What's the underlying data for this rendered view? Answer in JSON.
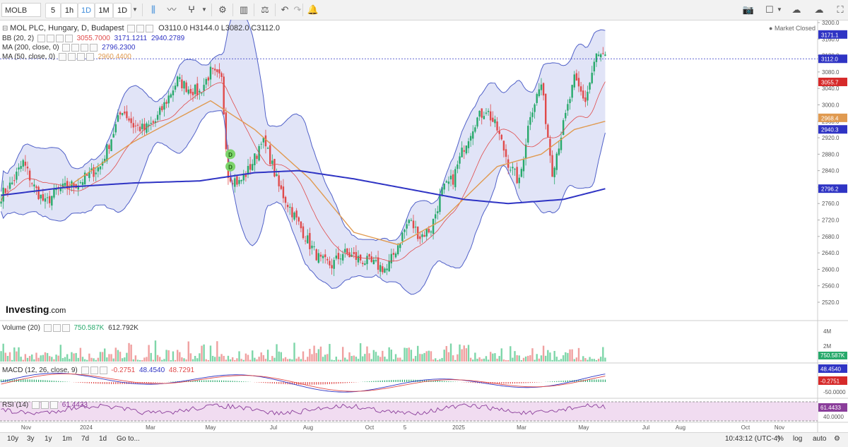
{
  "toolbar": {
    "symbol": "MOLB",
    "intervals": [
      "5",
      "1h",
      "1D",
      "1M",
      "1D"
    ],
    "active_interval": "1D"
  },
  "legend": {
    "title": "MOL PLC, Hungary, D, Budapest",
    "ohlc": {
      "o": "O3110.0",
      "h": "H3144.0",
      "l": "L3082.0",
      "c": "C3112.0"
    },
    "bb": {
      "label": "BB (20, 2)",
      "v1": "3055.7000",
      "v2": "3171.1211",
      "v3": "2940.2789"
    },
    "ma200": {
      "label": "MA (200, close, 0)",
      "v": "2796.2300"
    },
    "ma50": {
      "label": "MA (50, close, 0)",
      "v": "2960.4400"
    },
    "market_status": "Market Closed"
  },
  "logo": {
    "main": "Investing",
    "suffix": ".com"
  },
  "volume_legend": {
    "label": "Volume (20)",
    "v1": "750.587K",
    "v2": "612.792K"
  },
  "macd_legend": {
    "label": "MACD (12, 26, close, 9)",
    "v1": "-0.2751",
    "v2": "48.4540",
    "v3": "48.7291"
  },
  "rsi_legend": {
    "label": "RSI (14)",
    "v": "61.4433"
  },
  "bottom": {
    "ranges": [
      "10y",
      "3y",
      "1y",
      "1m",
      "7d",
      "1d",
      "Go to..."
    ],
    "time": "10:43:12 (UTC-4)",
    "pct": "%",
    "log": "log",
    "auto": "auto"
  },
  "colors": {
    "up": "#27a96b",
    "down": "#e04a4a",
    "bb": "#5060c8",
    "ma200": "#2f34c4",
    "ma50": "#e09a50",
    "rsi": "#8a3d9a"
  },
  "chart_data": {
    "type": "line",
    "x_labels": [
      "Nov",
      "2024",
      "Mar",
      "May",
      "Jul",
      "Aug",
      "Oct",
      "5",
      "2025",
      "Mar",
      "May",
      "Jul",
      "Aug",
      "Oct",
      "Nov"
    ],
    "price_axis": {
      "ticks": [
        3200,
        3160,
        3120,
        3080,
        3040,
        3000,
        2960,
        2920,
        2880,
        2840,
        2800,
        2760,
        2720,
        2680,
        2640,
        2600,
        2560,
        2520
      ],
      "ylim": [
        2520,
        3200
      ]
    },
    "series": [
      {
        "name": "MOL PLC",
        "keys": [
          [
            0,
            2780
          ],
          [
            5,
            2810
          ],
          [
            10,
            2860
          ],
          [
            15,
            2800
          ],
          [
            20,
            2760
          ],
          [
            25,
            2790
          ],
          [
            30,
            2800
          ],
          [
            35,
            2810
          ],
          [
            40,
            2830
          ],
          [
            45,
            2850
          ],
          [
            50,
            2920
          ],
          [
            55,
            2990
          ],
          [
            60,
            2950
          ],
          [
            65,
            2940
          ],
          [
            70,
            2960
          ],
          [
            75,
            3010
          ],
          [
            80,
            3060
          ],
          [
            85,
            3040
          ],
          [
            90,
            3030
          ],
          [
            95,
            3080
          ],
          [
            100,
            3060
          ],
          [
            103,
            2830
          ],
          [
            108,
            2810
          ],
          [
            112,
            2840
          ],
          [
            116,
            2880
          ],
          [
            118,
            2920
          ],
          [
            122,
            2870
          ],
          [
            126,
            2800
          ],
          [
            130,
            2760
          ],
          [
            135,
            2710
          ],
          [
            140,
            2660
          ],
          [
            145,
            2620
          ],
          [
            150,
            2610
          ],
          [
            155,
            2640
          ],
          [
            160,
            2630
          ],
          [
            165,
            2620
          ],
          [
            170,
            2610
          ],
          [
            175,
            2600
          ],
          [
            180,
            2660
          ],
          [
            185,
            2720
          ],
          [
            190,
            2680
          ],
          [
            195,
            2700
          ],
          [
            200,
            2790
          ],
          [
            205,
            2820
          ],
          [
            210,
            2900
          ],
          [
            215,
            2960
          ],
          [
            220,
            2990
          ],
          [
            225,
            2940
          ],
          [
            230,
            2860
          ],
          [
            235,
            2810
          ],
          [
            240,
            2980
          ],
          [
            245,
            3050
          ],
          [
            250,
            2840
          ],
          [
            255,
            2950
          ],
          [
            260,
            3060
          ],
          [
            265,
            3010
          ],
          [
            270,
            3120
          ],
          [
            274,
            3112
          ]
        ]
      },
      {
        "name": "MA (200, close, 0)",
        "keys": [
          [
            0,
            2780
          ],
          [
            30,
            2800
          ],
          [
            60,
            2810
          ],
          [
            90,
            2815
          ],
          [
            115,
            2835
          ],
          [
            135,
            2840
          ],
          [
            160,
            2820
          ],
          [
            185,
            2795
          ],
          [
            210,
            2770
          ],
          [
            230,
            2760
          ],
          [
            255,
            2770
          ],
          [
            274,
            2796
          ]
        ]
      },
      {
        "name": "MA (50, close, 0)",
        "keys": [
          [
            0,
            2780
          ],
          [
            30,
            2800
          ],
          [
            60,
            2910
          ],
          [
            95,
            3010
          ],
          [
            115,
            2940
          ],
          [
            140,
            2820
          ],
          [
            160,
            2690
          ],
          [
            180,
            2660
          ],
          [
            200,
            2720
          ],
          [
            225,
            2850
          ],
          [
            245,
            2880
          ],
          [
            260,
            2940
          ],
          [
            274,
            2960
          ]
        ]
      }
    ],
    "last_values": {
      "close": 3112.0,
      "bb_upper": 3171.1,
      "bb_mid": 3055.7,
      "bb_lower": 2940.3,
      "ma50": 2968.4,
      "ma200": 2796.2
    },
    "volume_axis": {
      "ticks": [
        "4M",
        "2M"
      ],
      "last": "750.587K"
    },
    "macd_axis": {
      "ticks": [
        "48.4540",
        "-0.2751",
        "-50.0000"
      ]
    },
    "rsi_axis": {
      "ticks": [
        "61.4433",
        "40.0000"
      ]
    }
  }
}
